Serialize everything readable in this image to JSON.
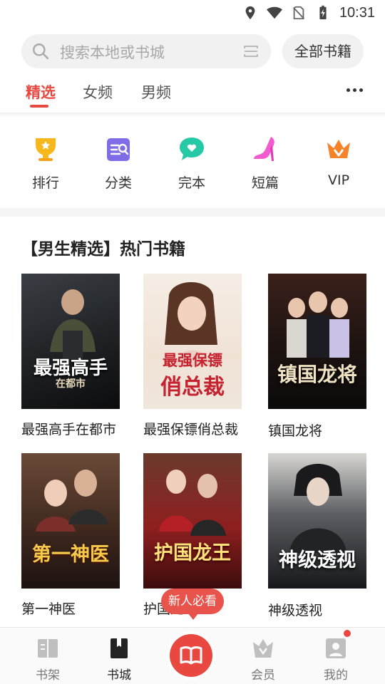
{
  "status_bar": {
    "time": "10:31"
  },
  "search": {
    "placeholder": "搜索本地或书城",
    "all_books_label": "全部书籍"
  },
  "tabs": [
    {
      "label": "精选",
      "active": true
    },
    {
      "label": "女频",
      "active": false
    },
    {
      "label": "男频",
      "active": false
    }
  ],
  "categories": [
    {
      "label": "排行",
      "icon": "trophy-icon"
    },
    {
      "label": "分类",
      "icon": "category-icon"
    },
    {
      "label": "完本",
      "icon": "complete-icon"
    },
    {
      "label": "短篇",
      "icon": "high-heel-icon"
    },
    {
      "label": "VIP",
      "icon": "crown-icon"
    }
  ],
  "section": {
    "title": "【男生精选】热门书籍",
    "books": [
      {
        "title": "最强高手在都市",
        "cover_text": "最强高手",
        "cover_sub": "在都市"
      },
      {
        "title": "最强保镖俏总裁",
        "cover_text": "最强保镖",
        "cover_sub": "俏总裁"
      },
      {
        "title": "镇国龙将",
        "cover_text": "镇国龙将",
        "cover_sub": ""
      },
      {
        "title": "第一神医",
        "cover_text": "第一神医",
        "cover_sub": ""
      },
      {
        "title": "护国龙王",
        "cover_text": "护国龙王",
        "cover_sub": ""
      },
      {
        "title": "神级透视",
        "cover_text": "神级透视",
        "cover_sub": ""
      }
    ]
  },
  "promo_bubble": "新人必看",
  "bottom_nav": [
    {
      "label": "书架",
      "icon": "bookshelf-icon",
      "active": false
    },
    {
      "label": "书城",
      "icon": "bookstore-icon",
      "active": true
    },
    {
      "label": "",
      "icon": "open-book-icon",
      "active": false
    },
    {
      "label": "会员",
      "icon": "vip-crown-icon",
      "active": false
    },
    {
      "label": "我的",
      "icon": "profile-icon",
      "active": false
    }
  ],
  "colors": {
    "accent": "#e8483f",
    "search_bg": "#f1f1f1"
  }
}
